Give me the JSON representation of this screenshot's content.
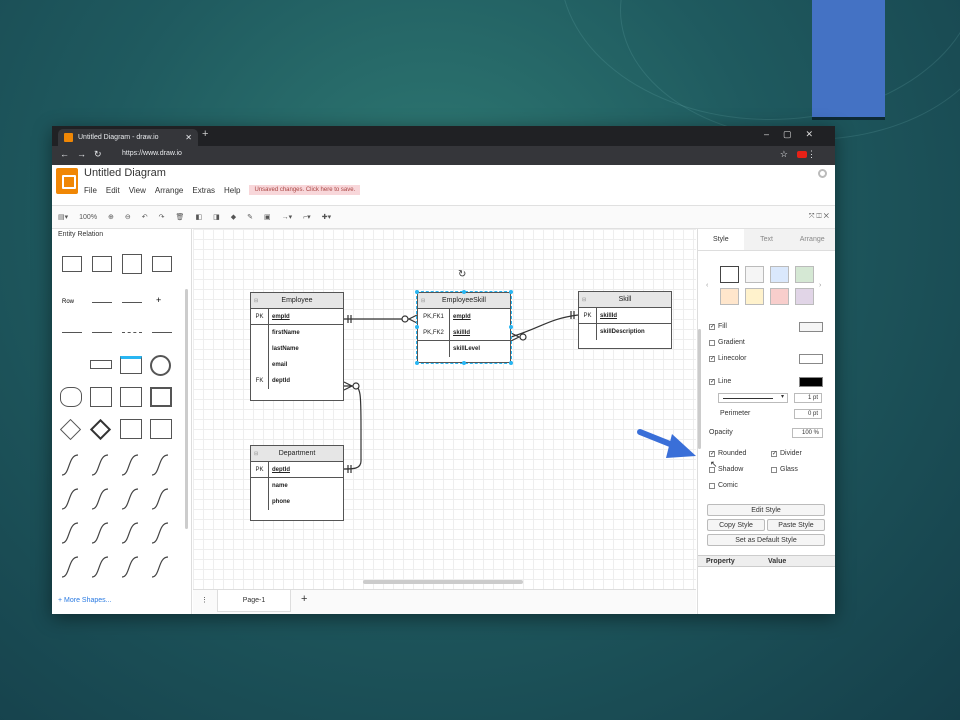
{
  "browser": {
    "tab_title": "Untitled Diagram - draw.io",
    "url": "https://www.draw.io"
  },
  "app": {
    "doc_title": "Untitled Diagram",
    "menu": [
      "File",
      "Edit",
      "View",
      "Arrange",
      "Extras",
      "Help"
    ],
    "unsaved_notice": "Unsaved changes. Click here to save.",
    "zoom": "100%"
  },
  "left_panel": {
    "section_title": "Entity Relation",
    "row_label": "Row",
    "more_shapes": "+ More Shapes..."
  },
  "diagram": {
    "employee": {
      "title": "Employee",
      "pk_key": "PK",
      "pk_field": "empId",
      "fields": [
        "firstName",
        "lastName",
        "email"
      ],
      "fk_key": "FK",
      "fk_field": "deptId"
    },
    "employee_skill": {
      "title": "EmployeeSkill",
      "rows": [
        {
          "key": "PK,FK1",
          "field": "empId"
        },
        {
          "key": "PK,FK2",
          "field": "skillId"
        }
      ],
      "extra_field": "skillLevel"
    },
    "skill": {
      "title": "Skill",
      "pk_key": "PK",
      "pk_field": "skillId",
      "fields": [
        "skillDescription"
      ]
    },
    "department": {
      "title": "Department",
      "pk_key": "PK",
      "pk_field": "deptId",
      "fields": [
        "name",
        "phone"
      ]
    }
  },
  "page_bar": {
    "page_name": "Page-1"
  },
  "format_panel": {
    "tabs": [
      "Style",
      "Text",
      "Arrange"
    ],
    "fill": "Fill",
    "gradient": "Gradient",
    "line_color": "Linecolor",
    "line": "Line",
    "line_width": "1 pt",
    "perimeter": "Perimeter",
    "perimeter_value": "0 pt",
    "opacity": "Opacity",
    "opacity_value": "100 %",
    "rounded": "Rounded",
    "divider": "Divider",
    "shadow": "Shadow",
    "glass": "Glass",
    "comic": "Comic",
    "edit_style": "Edit Style",
    "copy_style": "Copy Style",
    "paste_style": "Paste Style",
    "set_default": "Set as Default Style",
    "property": "Property",
    "value": "Value"
  },
  "colors": {
    "accent": "#29b6f2",
    "slide_rect": "#4472c4",
    "arrow": "#3a6fd8",
    "drawio_orange": "#f08705"
  }
}
